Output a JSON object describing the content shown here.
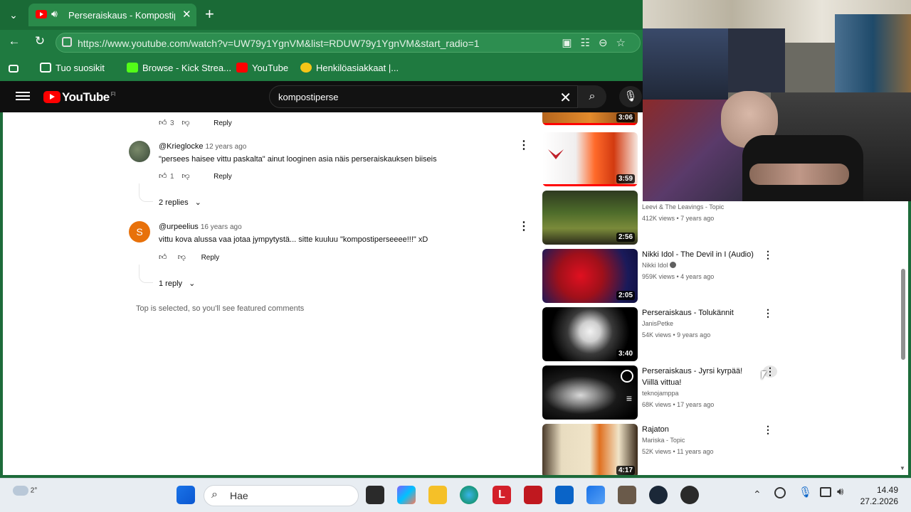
{
  "browser": {
    "tab_title": "Perseraiskaus - Kompostiperse",
    "url": "https://www.youtube.com/watch?v=UW79y1YgnVM&list=RDUW79y1YgnVM&start_radio=1",
    "bookmarks": [
      "Tuo suosikit",
      "Browse - Kick Strea...",
      "YouTube",
      "Henkilöasiakkaat |..."
    ]
  },
  "youtube": {
    "logo": "YouTube",
    "region": "FI",
    "search_query": "kompostiperse"
  },
  "comments": [
    {
      "likes": "3",
      "reply_label": "Reply"
    },
    {
      "author": "@Krieglocke",
      "time": "12 years ago",
      "text": "\"persees haisee vittu paskalta\" ainut looginen asia näis perseraiskauksen biiseis",
      "likes": "1",
      "reply_label": "Reply",
      "replies": "2 replies"
    },
    {
      "author": "@urpeelius",
      "avatar_letter": "S",
      "time": "16 years ago",
      "text": "vittu kova alussa vaa jotaa jympytystä... sitte kuuluu \"kompostiperseeee!!!\" xD",
      "likes": "",
      "reply_label": "Reply",
      "replies": "1 reply"
    }
  ],
  "footer_note": "Top is selected, so you'll see featured comments",
  "sidebar": [
    {
      "duration": "3:06"
    },
    {
      "duration": "3:59"
    },
    {
      "duration": "2:56",
      "channel": "Leevi & The Leavings - Topic",
      "meta": "412K views • 7 years ago"
    },
    {
      "duration": "2:05",
      "title": "Nikki Idol - The Devil in I (Audio)",
      "channel": "Nikki Idol",
      "meta": "959K views • 4 years ago"
    },
    {
      "duration": "3:40",
      "title": "Perseraiskaus - Tolukännit",
      "channel": "JanisPetke",
      "meta": "54K views • 9 years ago"
    },
    {
      "duration": "",
      "title": "Perseraiskaus - Jyrsi kyrpää! Viillä vittua!",
      "channel": "teknojamppa",
      "meta": "68K views • 17 years ago"
    },
    {
      "duration": "4:17",
      "title": "Rajaton",
      "channel": "Mariska - Topic",
      "meta": "52K views • 11 years ago"
    }
  ],
  "taskbar": {
    "weather": "2°",
    "search_placeholder": "Hae",
    "time": "14.49",
    "date": "27.2.2026"
  }
}
